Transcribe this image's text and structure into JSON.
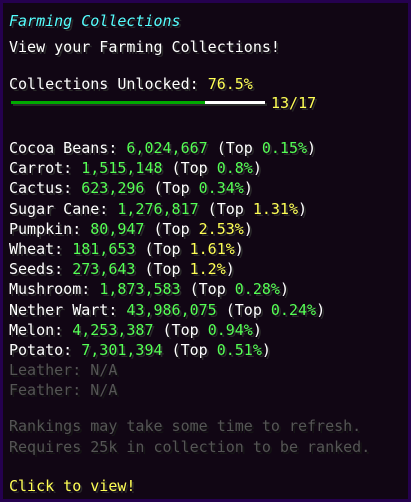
{
  "header": {
    "title": "Farming Collections",
    "subtitle": "View your Farming Collections!"
  },
  "unlocked": {
    "label": "Collections Unlocked: ",
    "percent": "76.5%",
    "progress_fraction": 0.765,
    "count": "13/17"
  },
  "collections": [
    {
      "name": "Cocoa Beans: ",
      "amount": "6,024,667",
      "open": " (Top ",
      "rank": "0.15%",
      "close": ")",
      "rank_color": "#55ff55"
    },
    {
      "name": "Carrot: ",
      "amount": "1,515,148",
      "open": " (Top ",
      "rank": "0.8%",
      "close": ")",
      "rank_color": "#55ff55"
    },
    {
      "name": "Cactus: ",
      "amount": "623,296",
      "open": " (Top ",
      "rank": "0.34%",
      "close": ")",
      "rank_color": "#55ff55"
    },
    {
      "name": "Sugar Cane: ",
      "amount": "1,276,817",
      "open": " (Top ",
      "rank": "1.31%",
      "close": ")",
      "rank_color": "#ffff55"
    },
    {
      "name": "Pumpkin: ",
      "amount": "80,947",
      "open": " (Top ",
      "rank": "2.53%",
      "close": ")",
      "rank_color": "#ffff55"
    },
    {
      "name": "Wheat: ",
      "amount": "181,653",
      "open": " (Top ",
      "rank": "1.61%",
      "close": ")",
      "rank_color": "#ffff55"
    },
    {
      "name": "Seeds: ",
      "amount": "273,643",
      "open": " (Top ",
      "rank": "1.2%",
      "close": ")",
      "rank_color": "#ffff55"
    },
    {
      "name": "Mushroom: ",
      "amount": "1,873,583",
      "open": " (Top ",
      "rank": "0.28%",
      "close": ")",
      "rank_color": "#55ff55"
    },
    {
      "name": "Nether Wart: ",
      "amount": "43,986,075",
      "open": " (Top ",
      "rank": "0.24%",
      "close": ")",
      "rank_color": "#55ff55"
    },
    {
      "name": "Melon: ",
      "amount": "4,253,387",
      "open": " (Top ",
      "rank": "0.94%",
      "close": ")",
      "rank_color": "#55ff55"
    },
    {
      "name": "Potato: ",
      "amount": "7,301,394",
      "open": " (Top ",
      "rank": "0.51%",
      "close": ")",
      "rank_color": "#55ff55"
    }
  ],
  "locked": [
    {
      "name": "Leather: ",
      "value": "N/A"
    },
    {
      "name": "Feather: ",
      "value": "N/A"
    }
  ],
  "notes": {
    "line1": "Rankings may take some time to refresh.",
    "line2": "Requires 25k in collection to be ranked."
  },
  "footer": {
    "action": "Click to view!"
  },
  "colors": {
    "title": "#55ffff",
    "label": "#ffffff",
    "value": "#55ff55",
    "highlight": "#ffff55",
    "muted": "#555555",
    "bar_filled": "#00aa00",
    "bar_empty": "#ffffff"
  }
}
